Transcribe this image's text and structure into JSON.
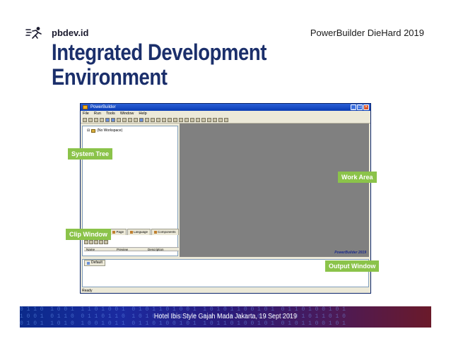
{
  "header": {
    "brand": "pbdev.id",
    "event": "PowerBuilder DieHard 2019",
    "title": "Integrated Development Environment"
  },
  "pb_window": {
    "title": "PowerBuilder",
    "menu": [
      "File",
      "Run",
      "Tools",
      "Window",
      "Help"
    ],
    "tree_root": "(No Workspace)",
    "tabs": [
      "Workspace",
      "Page",
      "Language",
      "Components"
    ],
    "clip_columns": [
      "Name",
      "Preview",
      "Description"
    ],
    "output_tab": "Default",
    "status": "Ready",
    "watermark": "PowerBuilder 2019"
  },
  "callouts": {
    "system_tree": "System Tree",
    "work_area": "Work Area",
    "clip_window": "Clip Window",
    "output_window": "Output Window"
  },
  "footer": {
    "text": "Hotel Ibis Style Gajah Mada Jakarta, 19 Sept 2019"
  },
  "colors": {
    "title": "#1b2f6b",
    "callout": "#8bc34a",
    "work_area": "#808080"
  }
}
